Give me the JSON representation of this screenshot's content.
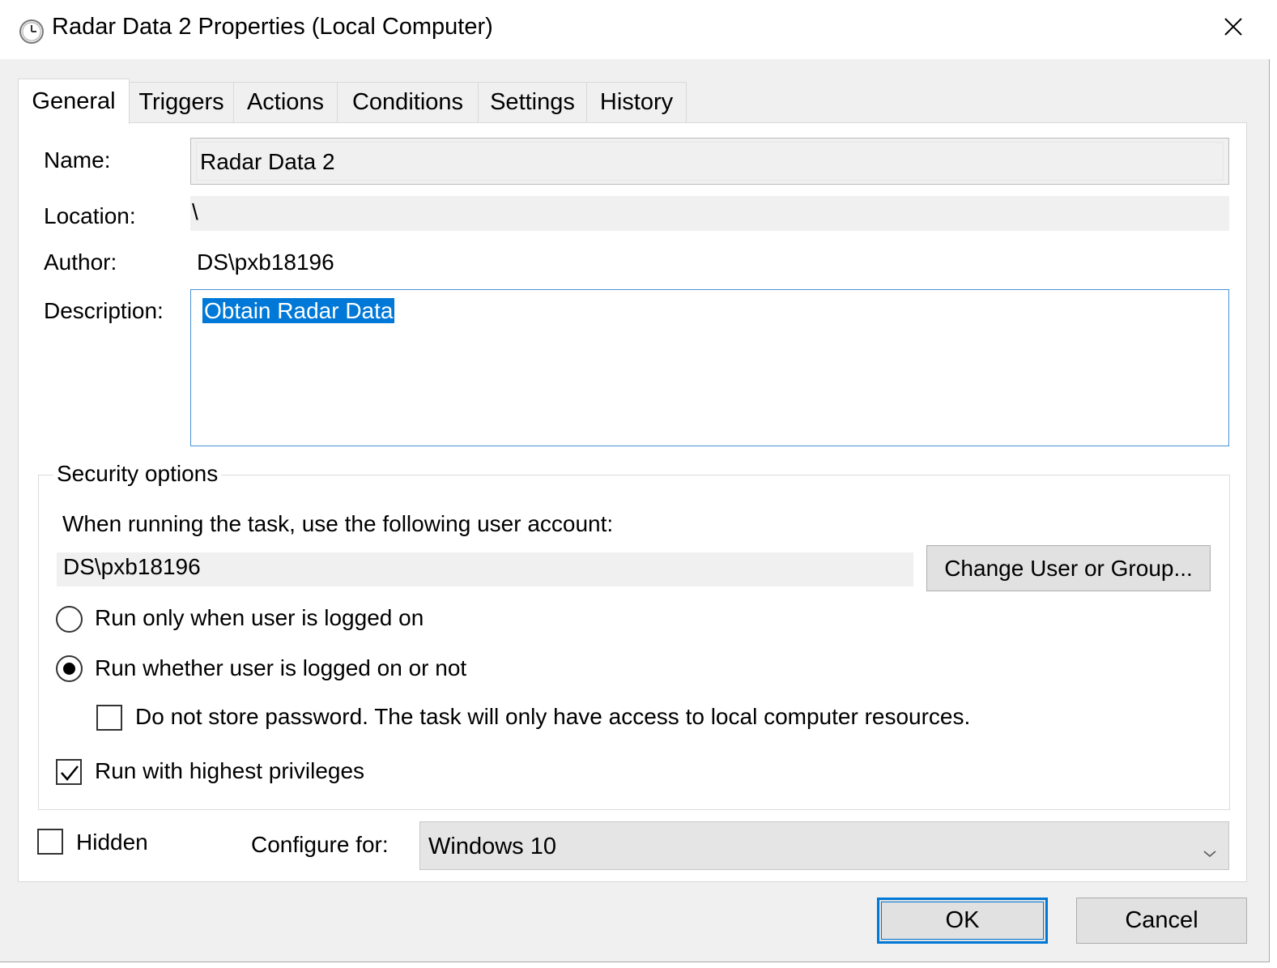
{
  "window": {
    "title": "Radar Data 2 Properties (Local Computer)",
    "title_icon": "clock-icon",
    "close_icon": "close-icon"
  },
  "tabs": [
    {
      "label": "General",
      "active": true
    },
    {
      "label": "Triggers",
      "active": false
    },
    {
      "label": "Actions",
      "active": false
    },
    {
      "label": "Conditions",
      "active": false
    },
    {
      "label": "Settings",
      "active": false
    },
    {
      "label": "History",
      "active": false
    }
  ],
  "general": {
    "name_label": "Name:",
    "name_value": "Radar Data 2",
    "location_label": "Location:",
    "location_value": "\\",
    "author_label": "Author:",
    "author_value": "DS\\pxb18196",
    "description_label": "Description:",
    "description_value": "Obtain Radar Data"
  },
  "security": {
    "title": "Security options",
    "account_prompt": "When running the task, use the following user account:",
    "account_value": "DS\\pxb18196",
    "change_button": "Change User or Group...",
    "radio_logged_on": {
      "label": "Run only when user is logged on",
      "selected": false
    },
    "radio_whether": {
      "label": "Run whether user is logged on or not",
      "selected": true
    },
    "no_store_password": {
      "label": "Do not store password.  The task will only have access to local computer resources.",
      "checked": false
    },
    "highest_privileges": {
      "label": "Run with highest privileges",
      "checked": true
    }
  },
  "footer": {
    "hidden": {
      "label": "Hidden",
      "checked": false
    },
    "configure_label": "Configure for:",
    "configure_value": "Windows 10"
  },
  "buttons": {
    "ok": "OK",
    "cancel": "Cancel"
  },
  "colors": {
    "accent": "#0078d7",
    "panel": "#ffffff",
    "background": "#f0f0f0"
  }
}
